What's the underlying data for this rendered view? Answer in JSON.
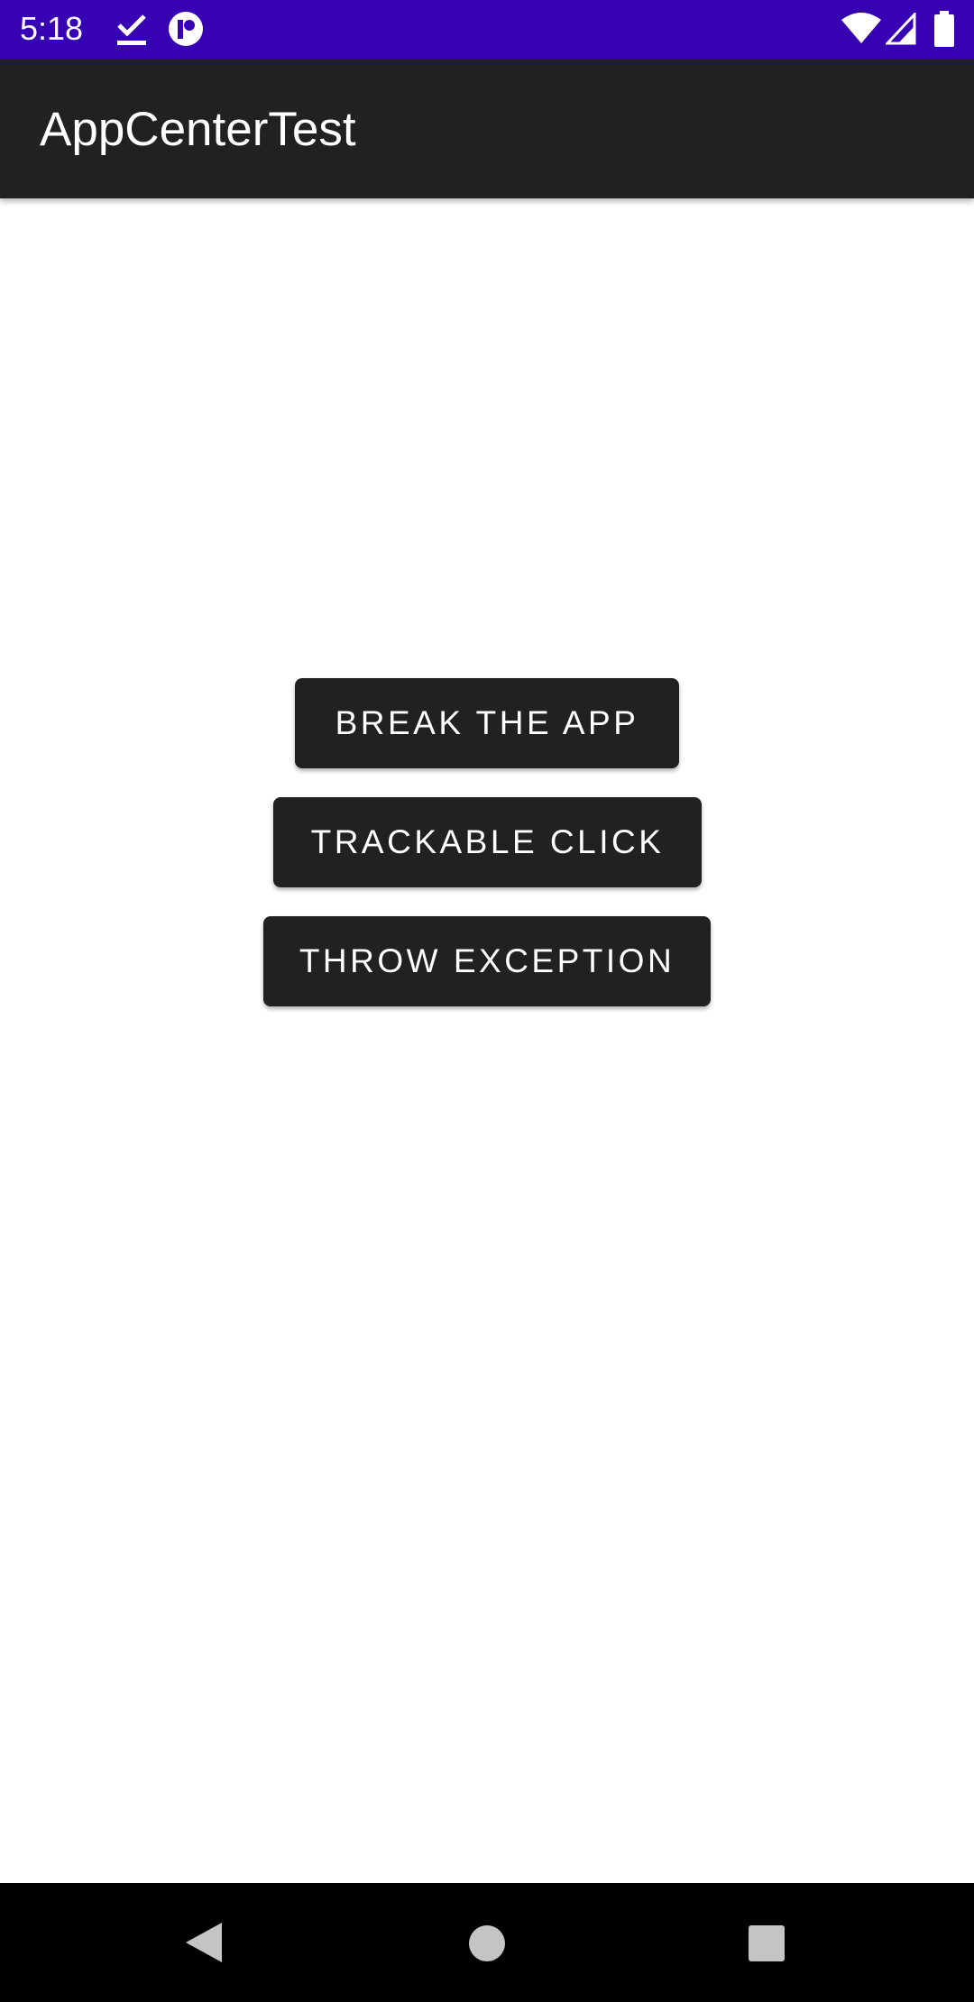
{
  "status_bar": {
    "time": "5:18",
    "background_color": "#3700b3",
    "icons": [
      "download-done-icon",
      "app-notification-icon",
      "wifi-icon",
      "signal-icon",
      "battery-icon"
    ]
  },
  "app_bar": {
    "title": "AppCenterTest",
    "background_color": "#212121"
  },
  "main": {
    "buttons": [
      {
        "label": "BREAK THE APP"
      },
      {
        "label": "TRACKABLE CLICK"
      },
      {
        "label": "THROW EXCEPTION"
      }
    ],
    "button_color": "#212121"
  },
  "nav_bar": {
    "icons": [
      "back-icon",
      "home-icon",
      "recents-icon"
    ]
  }
}
